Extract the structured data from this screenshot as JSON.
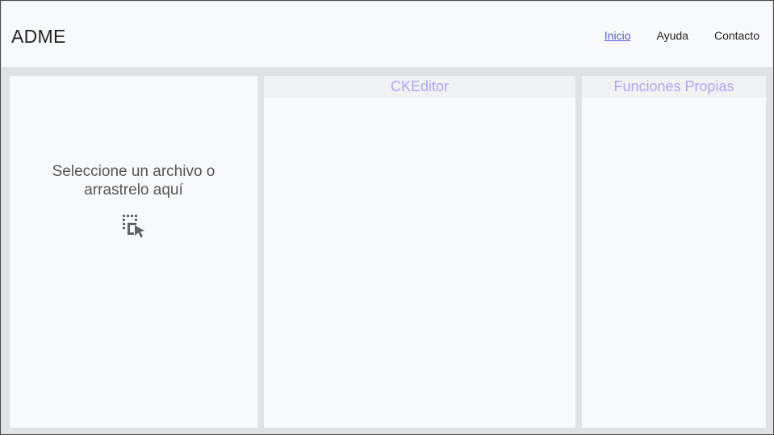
{
  "header": {
    "brand": "ADME",
    "nav": [
      {
        "label": "Inicio",
        "active": true
      },
      {
        "label": "Ayuda",
        "active": false
      },
      {
        "label": "Contacto",
        "active": false
      }
    ]
  },
  "upload": {
    "prompt": "Seleccione un archivo o arrastrelo aquí",
    "icon": "select-drag-cursor-icon"
  },
  "editor_panel": {
    "title": "CKEditor"
  },
  "functions_panel": {
    "title": "Funciones Propias"
  },
  "colors": {
    "accent": "#5a5cd6",
    "panel_title": "#a9a8f6",
    "background": "#dfe1e5",
    "panel": "#f8f9fa"
  }
}
